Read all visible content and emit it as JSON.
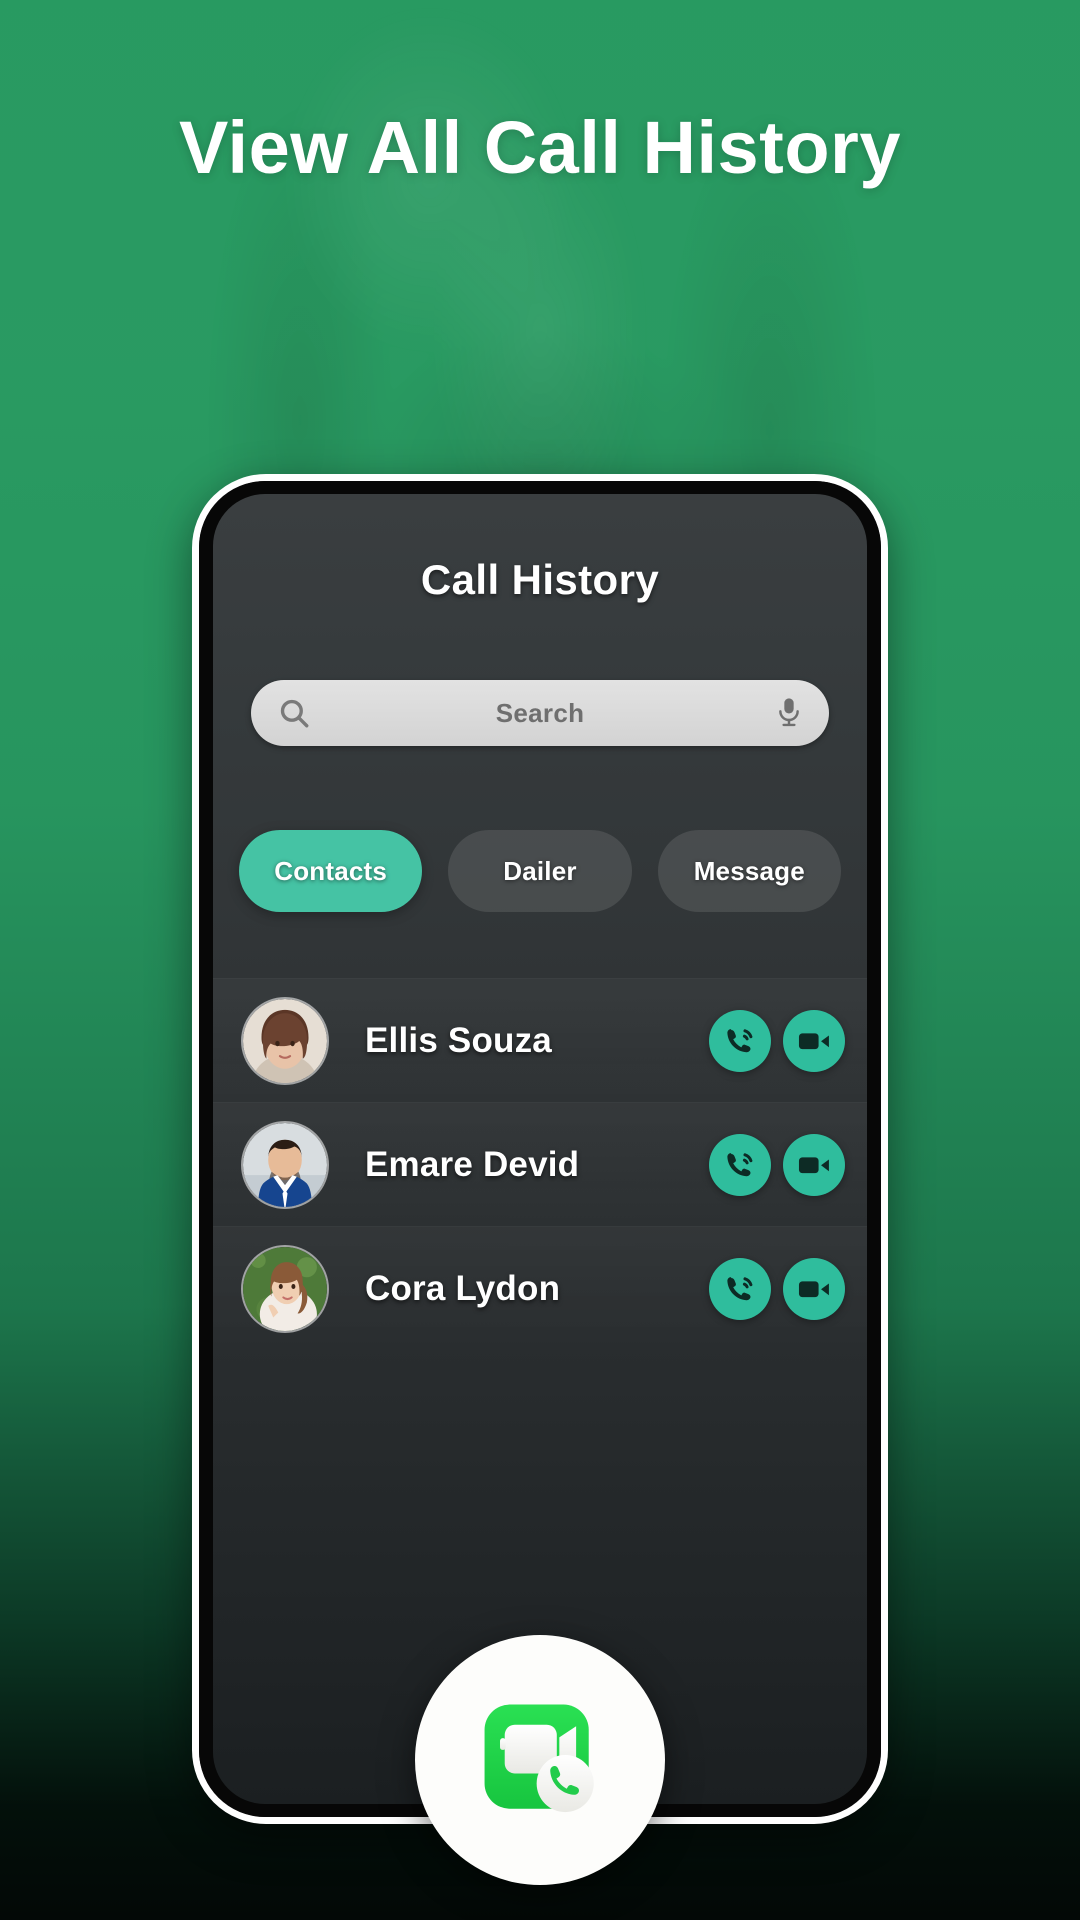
{
  "promo": {
    "headline": "View All Call History",
    "background_color": "#2a9b62",
    "bottom_fade_color": "#030806"
  },
  "phone": {
    "screen": {
      "title": "Call History",
      "background_color": "#303436",
      "search": {
        "placeholder": "Search",
        "value": "",
        "left_icon": "search-icon",
        "right_icon": "microphone-icon",
        "field_color": "#d8d8d8"
      },
      "filters": {
        "active_color": "#45c3a4",
        "items": [
          {
            "label": "Contacts",
            "active": true
          },
          {
            "label": "Dailer",
            "active": false
          },
          {
            "label": "Message",
            "active": false
          }
        ]
      },
      "contacts": {
        "action_button_color": "#2fbd9d",
        "items": [
          {
            "name": "Ellis Souza",
            "avatar": "woman-brown-bob-portrait",
            "actions": [
              {
                "icon": "phone-call-icon",
                "label": "Voice call"
              },
              {
                "icon": "video-camera-icon",
                "label": "Video call"
              }
            ]
          },
          {
            "name": "Emare Devid",
            "avatar": "man-blue-suit-portrait",
            "actions": [
              {
                "icon": "phone-call-icon",
                "label": "Voice call"
              },
              {
                "icon": "video-camera-icon",
                "label": "Video call"
              }
            ]
          },
          {
            "name": "Cora Lydon",
            "avatar": "woman-white-dress-portrait",
            "actions": [
              {
                "icon": "phone-call-icon",
                "label": "Voice call"
              },
              {
                "icon": "video-camera-icon",
                "label": "Video call"
              }
            ]
          }
        ]
      }
    }
  },
  "app_icon": {
    "name": "video-call-app-icon",
    "camera_color": "#22cc4b",
    "badge_color": "#ffffff"
  }
}
